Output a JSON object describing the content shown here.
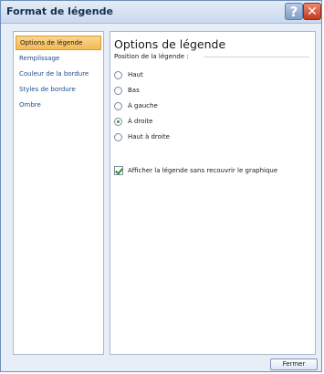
{
  "window": {
    "title": "Format de légende",
    "help_glyph": "?",
    "close_glyph": "✕"
  },
  "sidebar": {
    "items": [
      {
        "label": "Options de légende",
        "active": true
      },
      {
        "label": "Remplissage",
        "active": false
      },
      {
        "label": "Couleur de la bordure",
        "active": false
      },
      {
        "label": "Styles de bordure",
        "active": false
      },
      {
        "label": "Ombre",
        "active": false
      }
    ]
  },
  "panel": {
    "title": "Options de légende",
    "position_group_label": "Position de la légende :",
    "options": [
      {
        "label": "Haut",
        "checked": false
      },
      {
        "label": "Bas",
        "checked": false
      },
      {
        "label": "À gauche",
        "checked": false
      },
      {
        "label": "À droite",
        "checked": true
      },
      {
        "label": "Haut à droite",
        "checked": false
      }
    ],
    "overlay_checkbox": {
      "label": "Afficher la légende sans recouvrir le graphique",
      "checked": true
    }
  },
  "footer": {
    "close_label": "Fermer"
  },
  "colors": {
    "active_item": "#f4b954",
    "link_text": "#1f4d8b",
    "close_button": "#c4391d"
  }
}
